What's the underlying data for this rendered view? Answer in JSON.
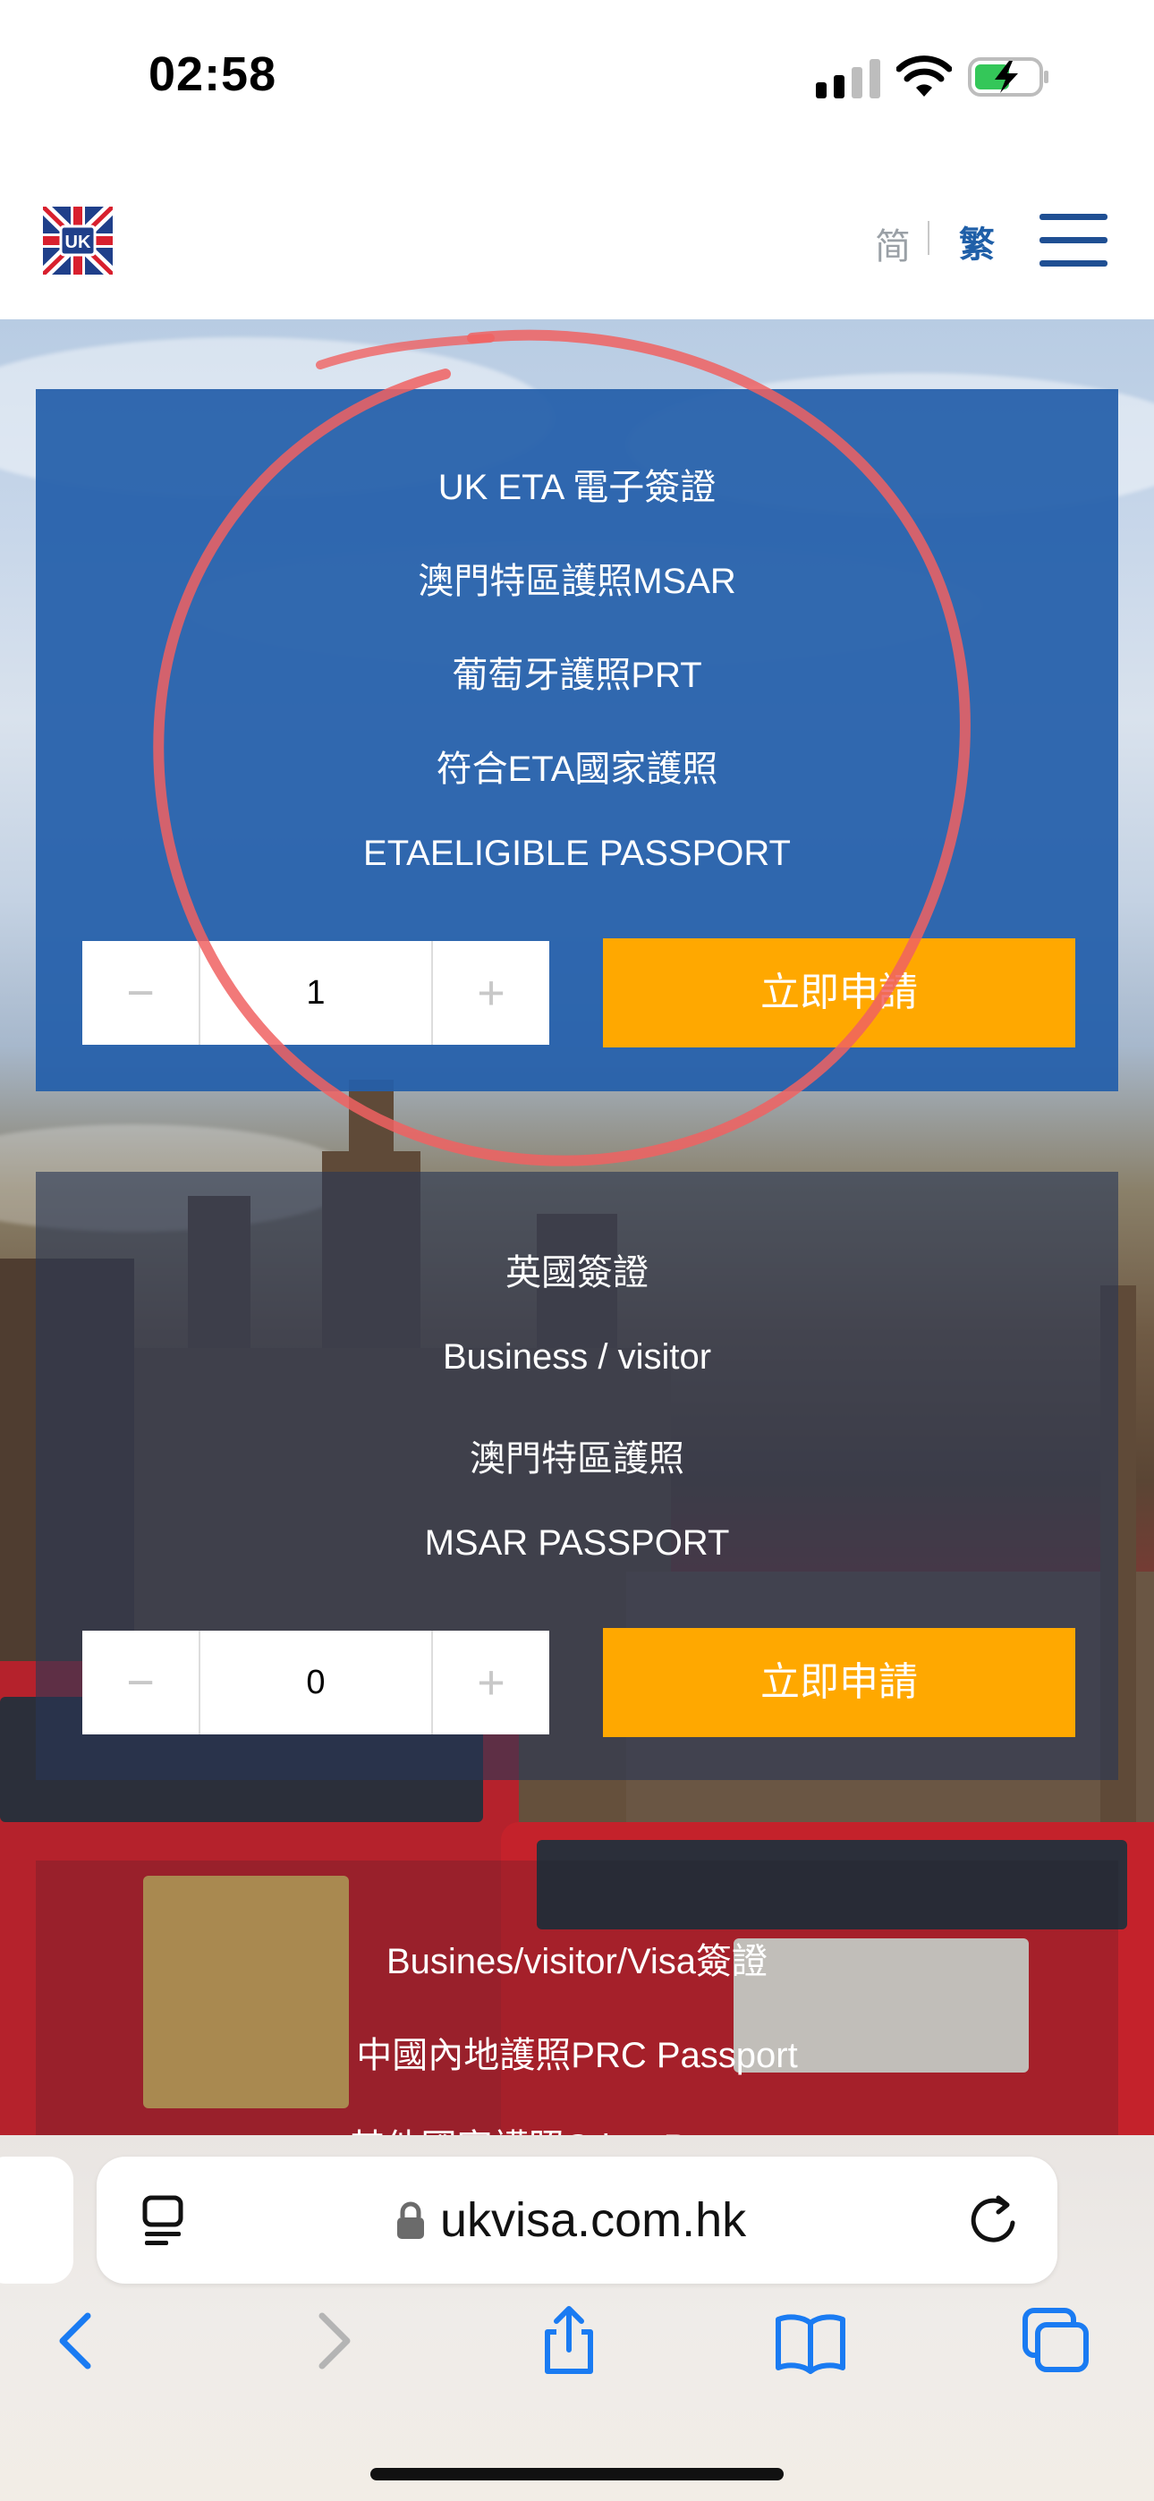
{
  "status_bar": {
    "time": "02:58"
  },
  "header": {
    "logo_text": "UK",
    "lang_simplified": "简",
    "lang_traditional": "繁"
  },
  "cards": [
    {
      "lines": [
        "UK ETA 電子簽證",
        "澳門特區護照MSAR",
        "葡萄牙護照PRT",
        "符合ETA國家護照",
        "ETAELIGIBLE PASSPORT"
      ],
      "quantity": "1",
      "minus": "−",
      "plus": "+",
      "apply_label": "立即申請"
    },
    {
      "lines": [
        "英國簽證",
        "Business / visitor",
        "澳門特區護照",
        "MSAR PASSPORT"
      ],
      "quantity": "0",
      "minus": "−",
      "plus": "+",
      "apply_label": "立即申請"
    },
    {
      "lines": [
        "Busines/visitor/Visa簽證",
        "中國內地護照PRC Passport",
        "其他國家護照Other Passport"
      ]
    }
  ],
  "browser": {
    "url": "ukvisa.com.hk"
  },
  "colors": {
    "card_blue": "#235faa",
    "apply_orange": "#ffa800",
    "annotation_red": "#f06262",
    "ios_blue": "#1a7bf2"
  }
}
